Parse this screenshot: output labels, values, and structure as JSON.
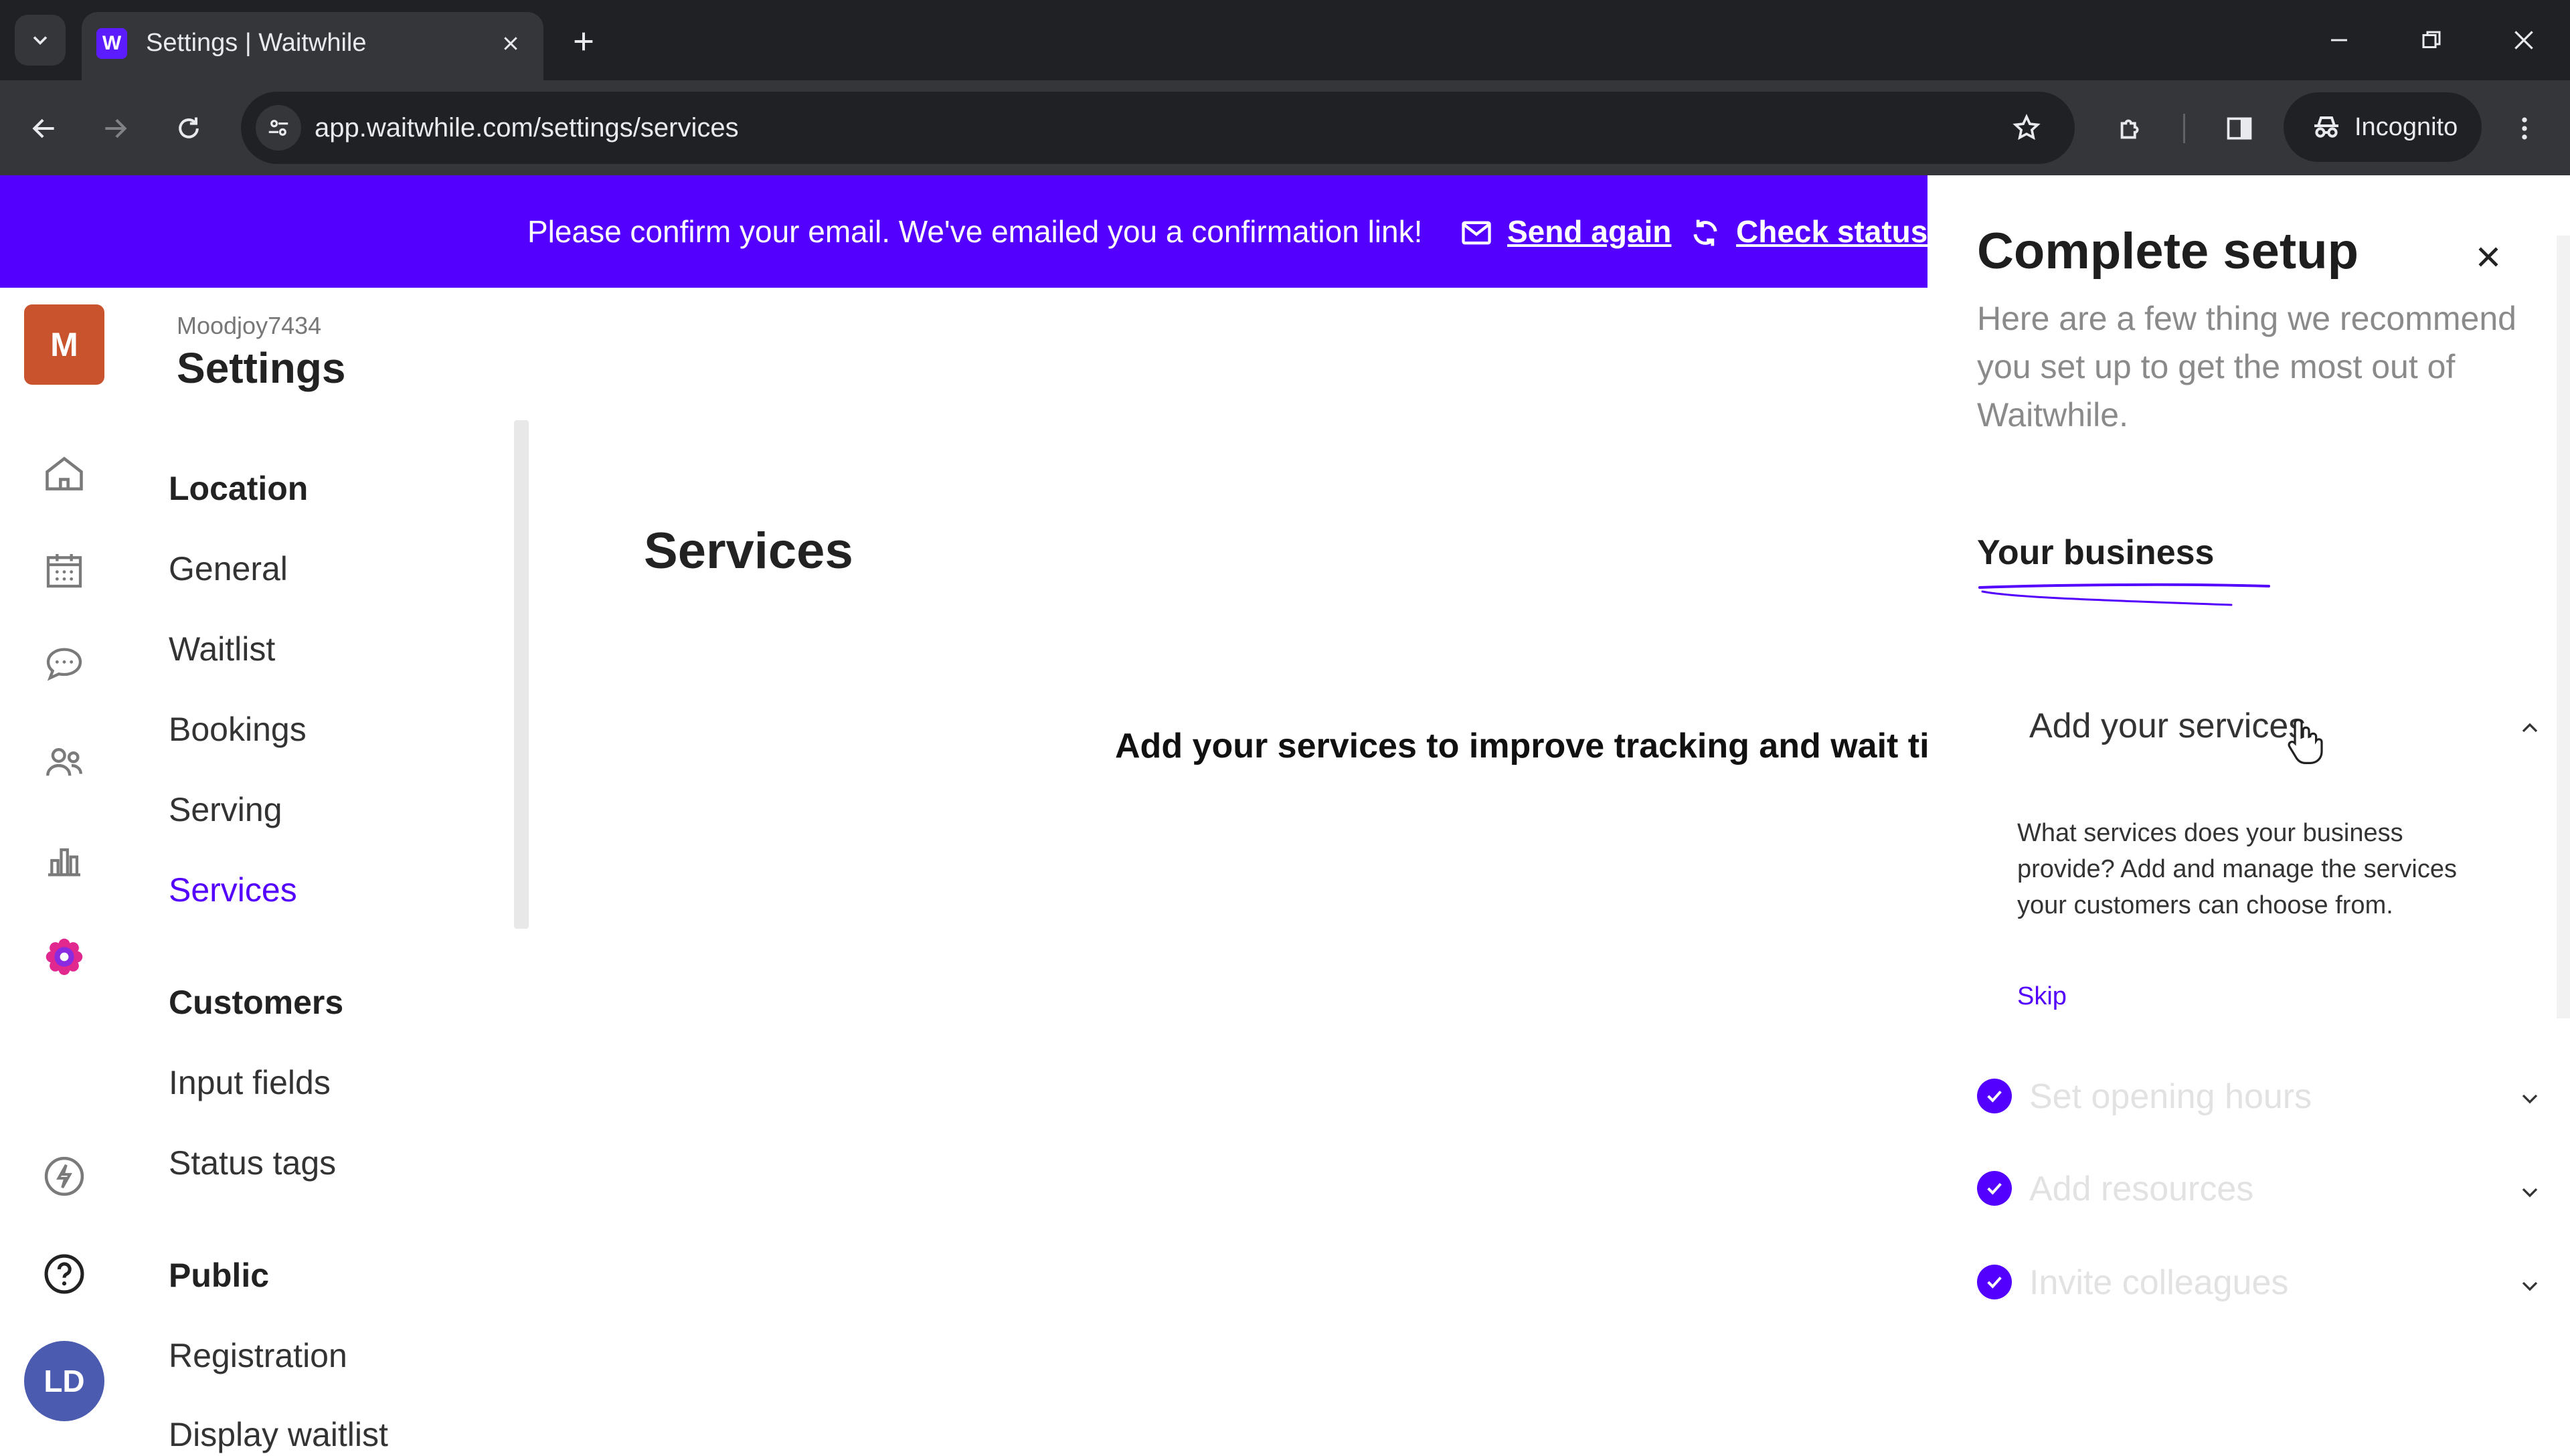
{
  "browser": {
    "tab_title": "Settings | Waitwhile",
    "favicon_letter": "W",
    "url": "app.waitwhile.com/settings/services",
    "profile_label": "Incognito"
  },
  "banner": {
    "message": "Please confirm your email. We've emailed you a confirmation link!",
    "send_again": "Send again",
    "check_status": "Check status"
  },
  "rail": {
    "account_initial": "M",
    "user_initials": "LD"
  },
  "settings_nav": {
    "account_name": "Moodjoy7434",
    "title": "Settings",
    "groups": [
      {
        "label": "Location",
        "items": [
          "General",
          "Waitlist",
          "Bookings",
          "Serving",
          "Services"
        ]
      },
      {
        "label": "Customers",
        "items": [
          "Input fields",
          "Status tags"
        ]
      },
      {
        "label": "Public",
        "items": [
          "Registration",
          "Display waitlist"
        ]
      }
    ],
    "active_item": "Services"
  },
  "main": {
    "heading": "Services",
    "empty_hint": "Add your services to improve tracking and wait tir"
  },
  "setup_panel": {
    "title": "Complete setup",
    "description": "Here are a few thing we recommend you set up to get the most out of Waitwhile.",
    "section_title": "Your business",
    "open_step": {
      "title": "Add your services",
      "body": "What services does your business provide? Add and manage the services your customers can choose from.",
      "skip_label": "Skip"
    },
    "completed_steps": [
      "Set opening hours",
      "Add resources",
      "Invite colleagues"
    ]
  },
  "colors": {
    "accent": "#5400ff",
    "account_avatar": "#c8532c",
    "user_avatar": "#4a5bb0",
    "chrome_dark": "#202124",
    "chrome_mid": "#35363a"
  }
}
